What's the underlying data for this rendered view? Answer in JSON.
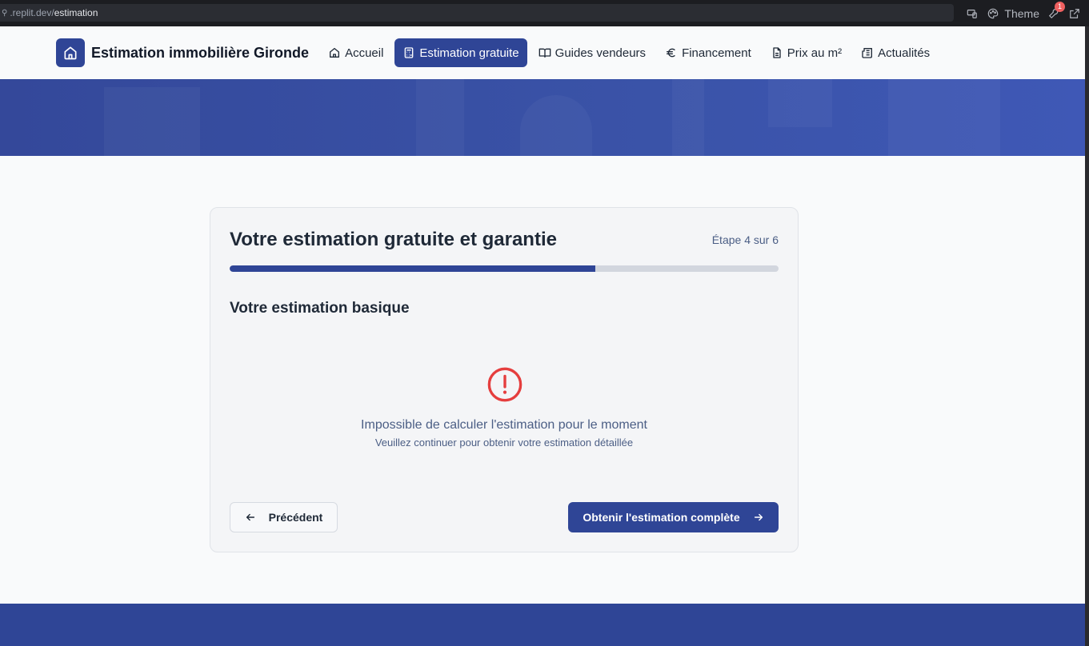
{
  "browser": {
    "url_host": ".replit.dev/",
    "url_path": "estimation",
    "theme_label": "Theme",
    "notification_count": "1"
  },
  "header": {
    "brand": "Estimation immobilière Gironde",
    "nav": [
      {
        "label": "Accueil",
        "icon": "home-icon",
        "active": false
      },
      {
        "label": "Estimation gratuite",
        "icon": "calculator-icon",
        "active": true
      },
      {
        "label": "Guides vendeurs",
        "icon": "book-icon",
        "active": false
      },
      {
        "label": "Financement",
        "icon": "euro-icon",
        "active": false
      },
      {
        "label": "Prix au m²",
        "icon": "document-icon",
        "active": false
      },
      {
        "label": "Actualités",
        "icon": "newspaper-icon",
        "active": false
      }
    ]
  },
  "card": {
    "title": "Votre estimation gratuite et garantie",
    "step_label": "Étape 4 sur 6",
    "progress_fraction": 0.6667,
    "section_title": "Votre estimation basique",
    "error_main": "Impossible de calculer l'estimation pour le moment",
    "error_sub": "Veuillez continuer pour obtenir votre estimation détaillée",
    "prev_label": "Précédent",
    "next_label": "Obtenir l'estimation complète"
  },
  "colors": {
    "primary": "#2f4596",
    "error": "#e53e3e",
    "muted_text": "#4b5e85"
  }
}
